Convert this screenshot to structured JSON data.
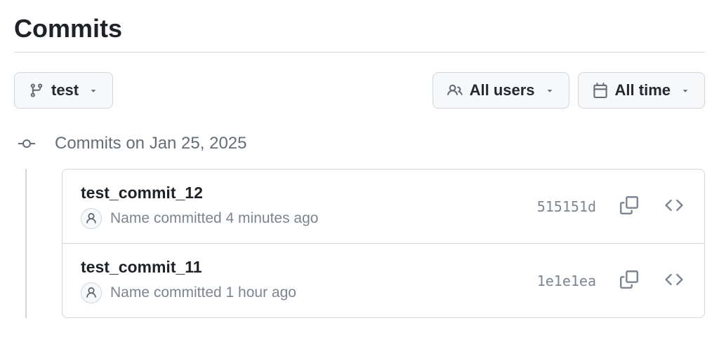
{
  "header": {
    "title": "Commits"
  },
  "filters": {
    "branch_label": "test",
    "users_label": "All users",
    "time_label": "All time"
  },
  "timeline": {
    "date_heading": "Commits on Jan 25, 2025"
  },
  "commits": [
    {
      "title": "test_commit_12",
      "author": "Name",
      "byline": "Name committed 4 minutes ago",
      "sha": "515151d"
    },
    {
      "title": "test_commit_11",
      "author": "Name",
      "byline": "Name committed 1 hour ago",
      "sha": "1e1e1ea"
    }
  ]
}
